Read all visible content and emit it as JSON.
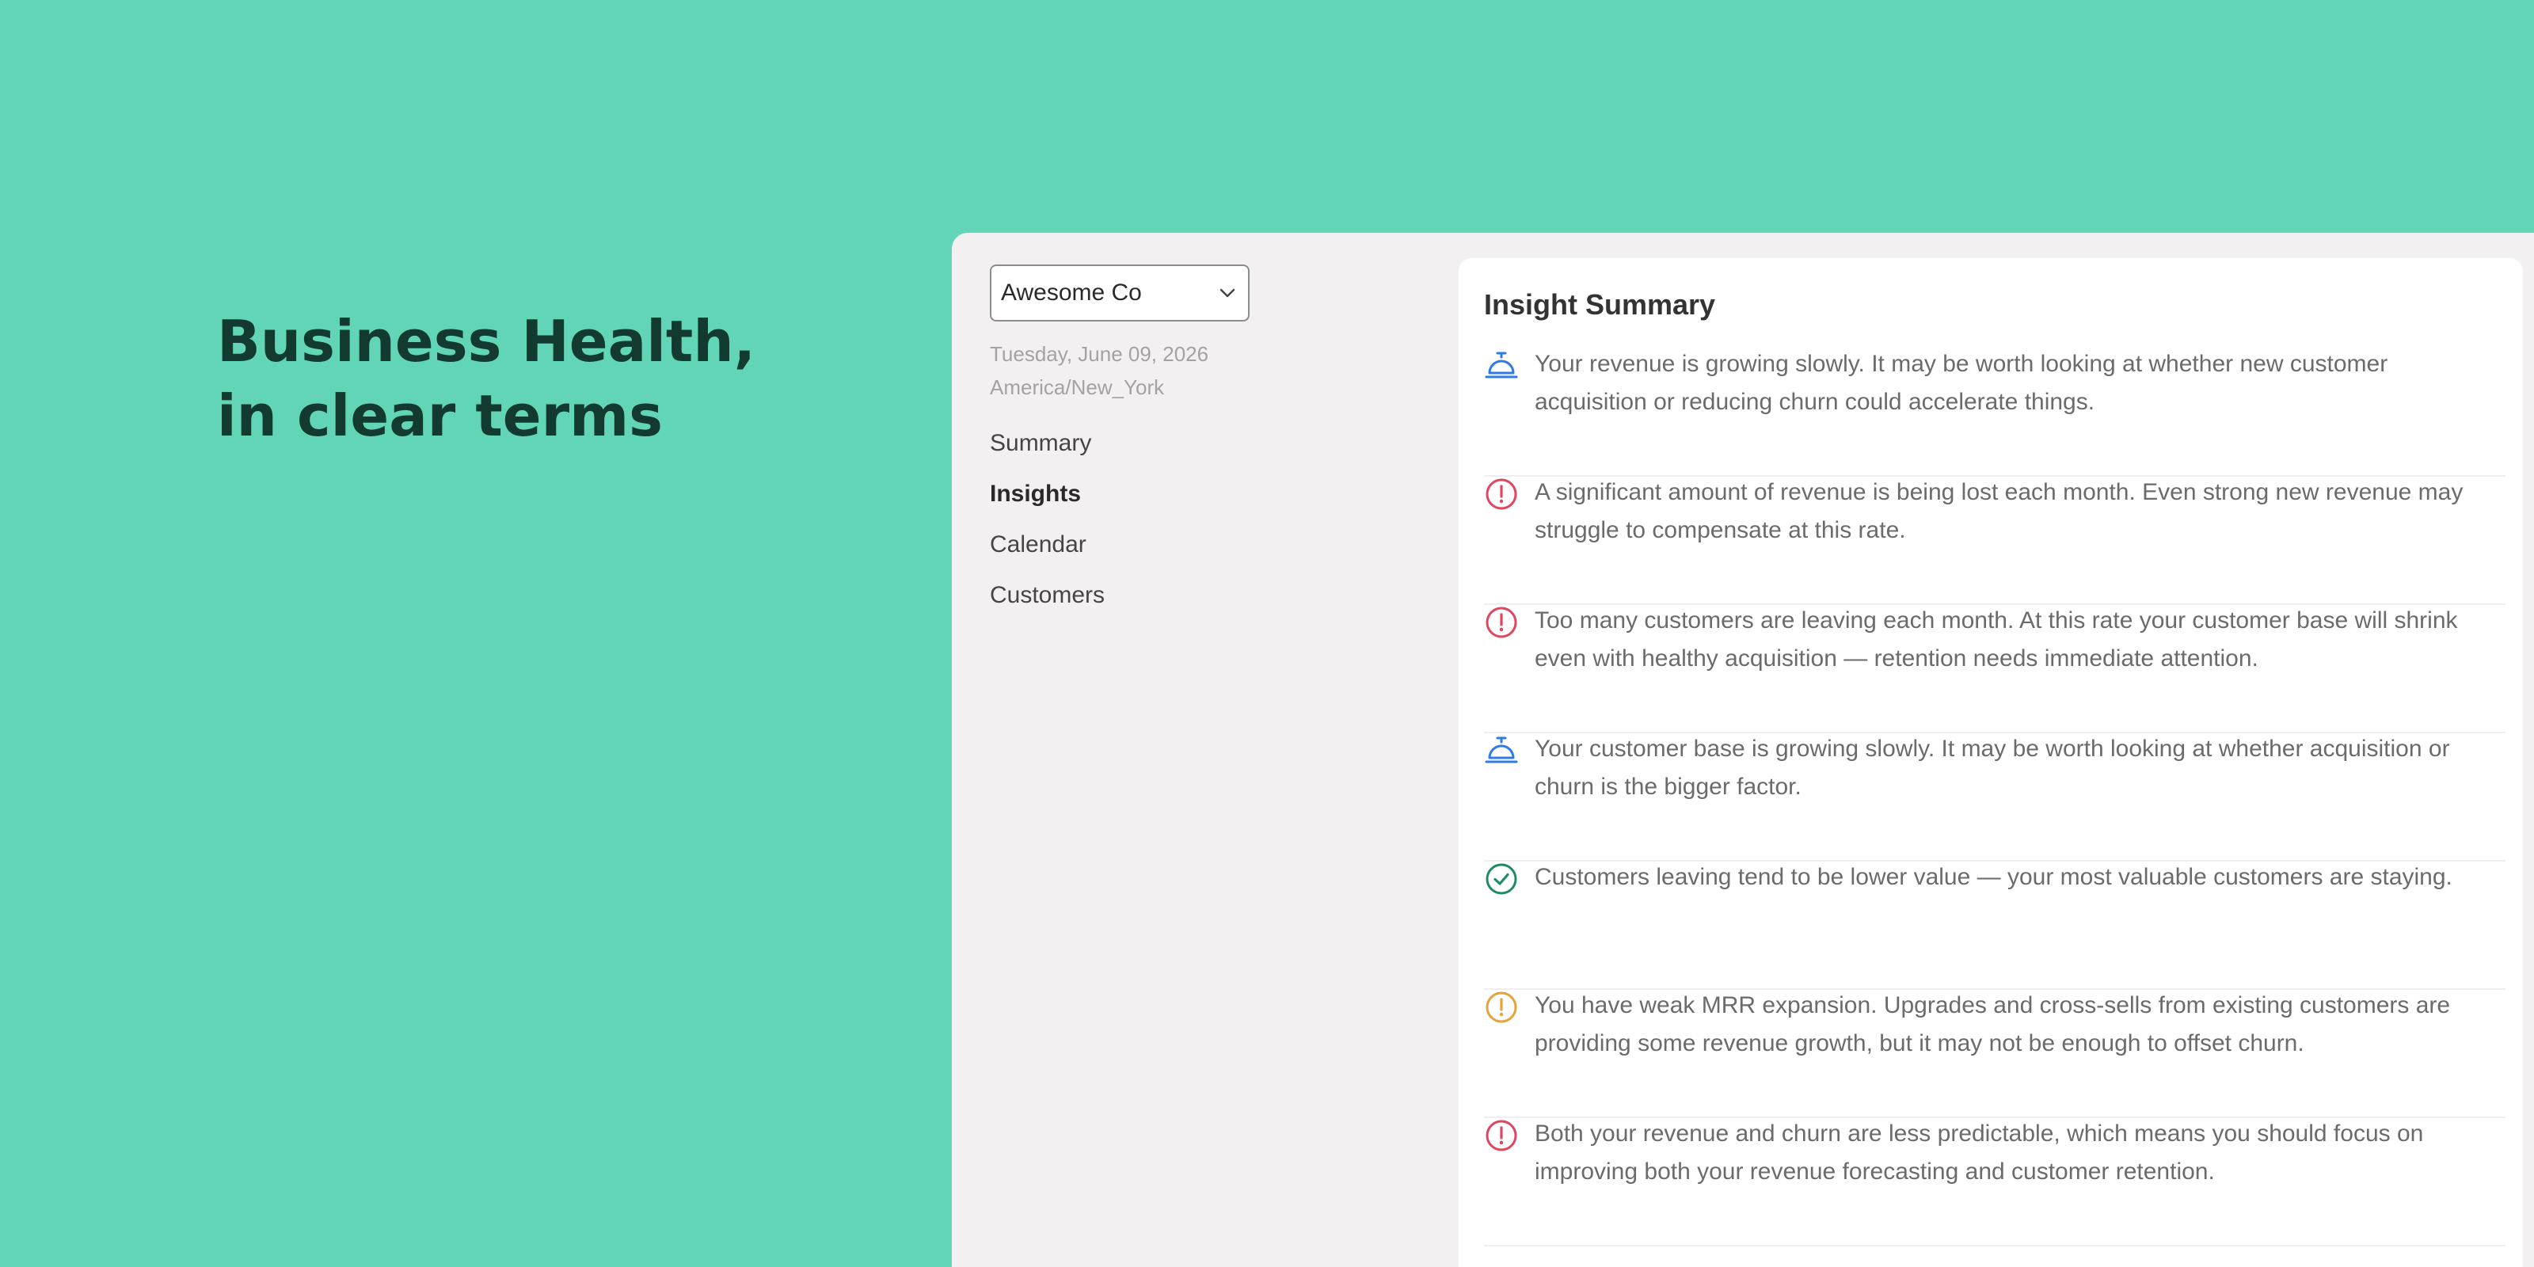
{
  "hero": {
    "line1": "Business Health,",
    "line2": "in clear terms"
  },
  "sidebar": {
    "company": "Awesome Co",
    "date": "Tuesday, June 09, 2026",
    "timezone": "America/New_York",
    "nav": [
      {
        "label": "Summary",
        "active": false
      },
      {
        "label": "Insights",
        "active": true
      },
      {
        "label": "Calendar",
        "active": false
      },
      {
        "label": "Customers",
        "active": false
      }
    ]
  },
  "panel": {
    "title": "Insight Summary",
    "insights": [
      {
        "icon": "service-bell-icon",
        "color": "#2f7be6",
        "text": "Your revenue is growing slowly. It may be worth looking at whether new customer acquisition or reducing churn could accelerate things."
      },
      {
        "icon": "alert-circle-icon",
        "color": "#e0475f",
        "text": "A significant amount of revenue is being lost each month. Even strong new revenue may struggle to compensate at this rate."
      },
      {
        "icon": "alert-circle-icon",
        "color": "#e0475f",
        "text": "Too many customers are leaving each month. At this rate your customer base will shrink even with healthy acquisition — retention needs immediate attention."
      },
      {
        "icon": "service-bell-icon",
        "color": "#2f7be6",
        "text": "Your customer base is growing slowly. It may be worth looking at whether acquisition or churn is the bigger factor."
      },
      {
        "icon": "check-circle-icon",
        "color": "#1f8a68",
        "text": "Customers leaving tend to be lower value — your most valuable customers are staying."
      },
      {
        "icon": "alert-circle-icon",
        "color": "#e6a23c",
        "text": "You have weak MRR expansion. Upgrades and cross-sells from existing customers are providing some revenue growth, but it may not be enough to offset churn."
      },
      {
        "icon": "alert-circle-icon",
        "color": "#e0475f",
        "text": "Both your revenue and churn are less predictable, which means you should focus on improving both your revenue forecasting and customer retention."
      }
    ]
  }
}
